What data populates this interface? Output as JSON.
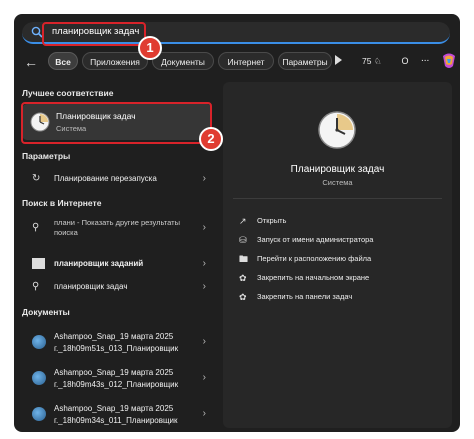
{
  "search": {
    "query": "планировщик задач"
  },
  "filters": {
    "chips": [
      "Все",
      "Приложения",
      "Документы",
      "Интернет",
      "Параметры"
    ],
    "points": "75",
    "avatar": "O",
    "more": "..."
  },
  "annotations": {
    "badge1": "1",
    "badge2": "2"
  },
  "best_match": {
    "header": "Лучшее соответствие",
    "title": "Планировщик задач",
    "subtitle": "Система"
  },
  "settings": {
    "header": "Параметры",
    "items": [
      {
        "label": "Планирование перезапуска"
      }
    ]
  },
  "web": {
    "header": "Поиск в Интернете",
    "items": [
      {
        "label": "плани - Показать другие результаты поиска"
      },
      {
        "label": "планировщик заданий"
      },
      {
        "label": "планировщик задач"
      }
    ]
  },
  "documents": {
    "header": "Документы",
    "items": [
      {
        "label": "Ashampoo_Snap_19 марта 2025 г._18h09m51s_013_Планировщик"
      },
      {
        "label": "Ashampoo_Snap_19 марта 2025 г._18h09m43s_012_Планировщик"
      },
      {
        "label": "Ashampoo_Snap_19 марта 2025 г._18h09m34s_011_Планировщик"
      }
    ]
  },
  "preview": {
    "title": "Планировщик задач",
    "subtitle": "Система",
    "actions": [
      {
        "label": "Открыть",
        "icon": "open-icon"
      },
      {
        "label": "Запуск от имени администратора",
        "icon": "admin-icon"
      },
      {
        "label": "Перейти к расположению файла",
        "icon": "folder-icon"
      },
      {
        "label": "Закрепить на начальном экране",
        "icon": "pin-icon"
      },
      {
        "label": "Закрепить на панели задач",
        "icon": "pin-icon"
      }
    ]
  },
  "colors": {
    "accent": "#3a8ee6",
    "highlight": "#d8232a",
    "badge": "#e03c31"
  }
}
